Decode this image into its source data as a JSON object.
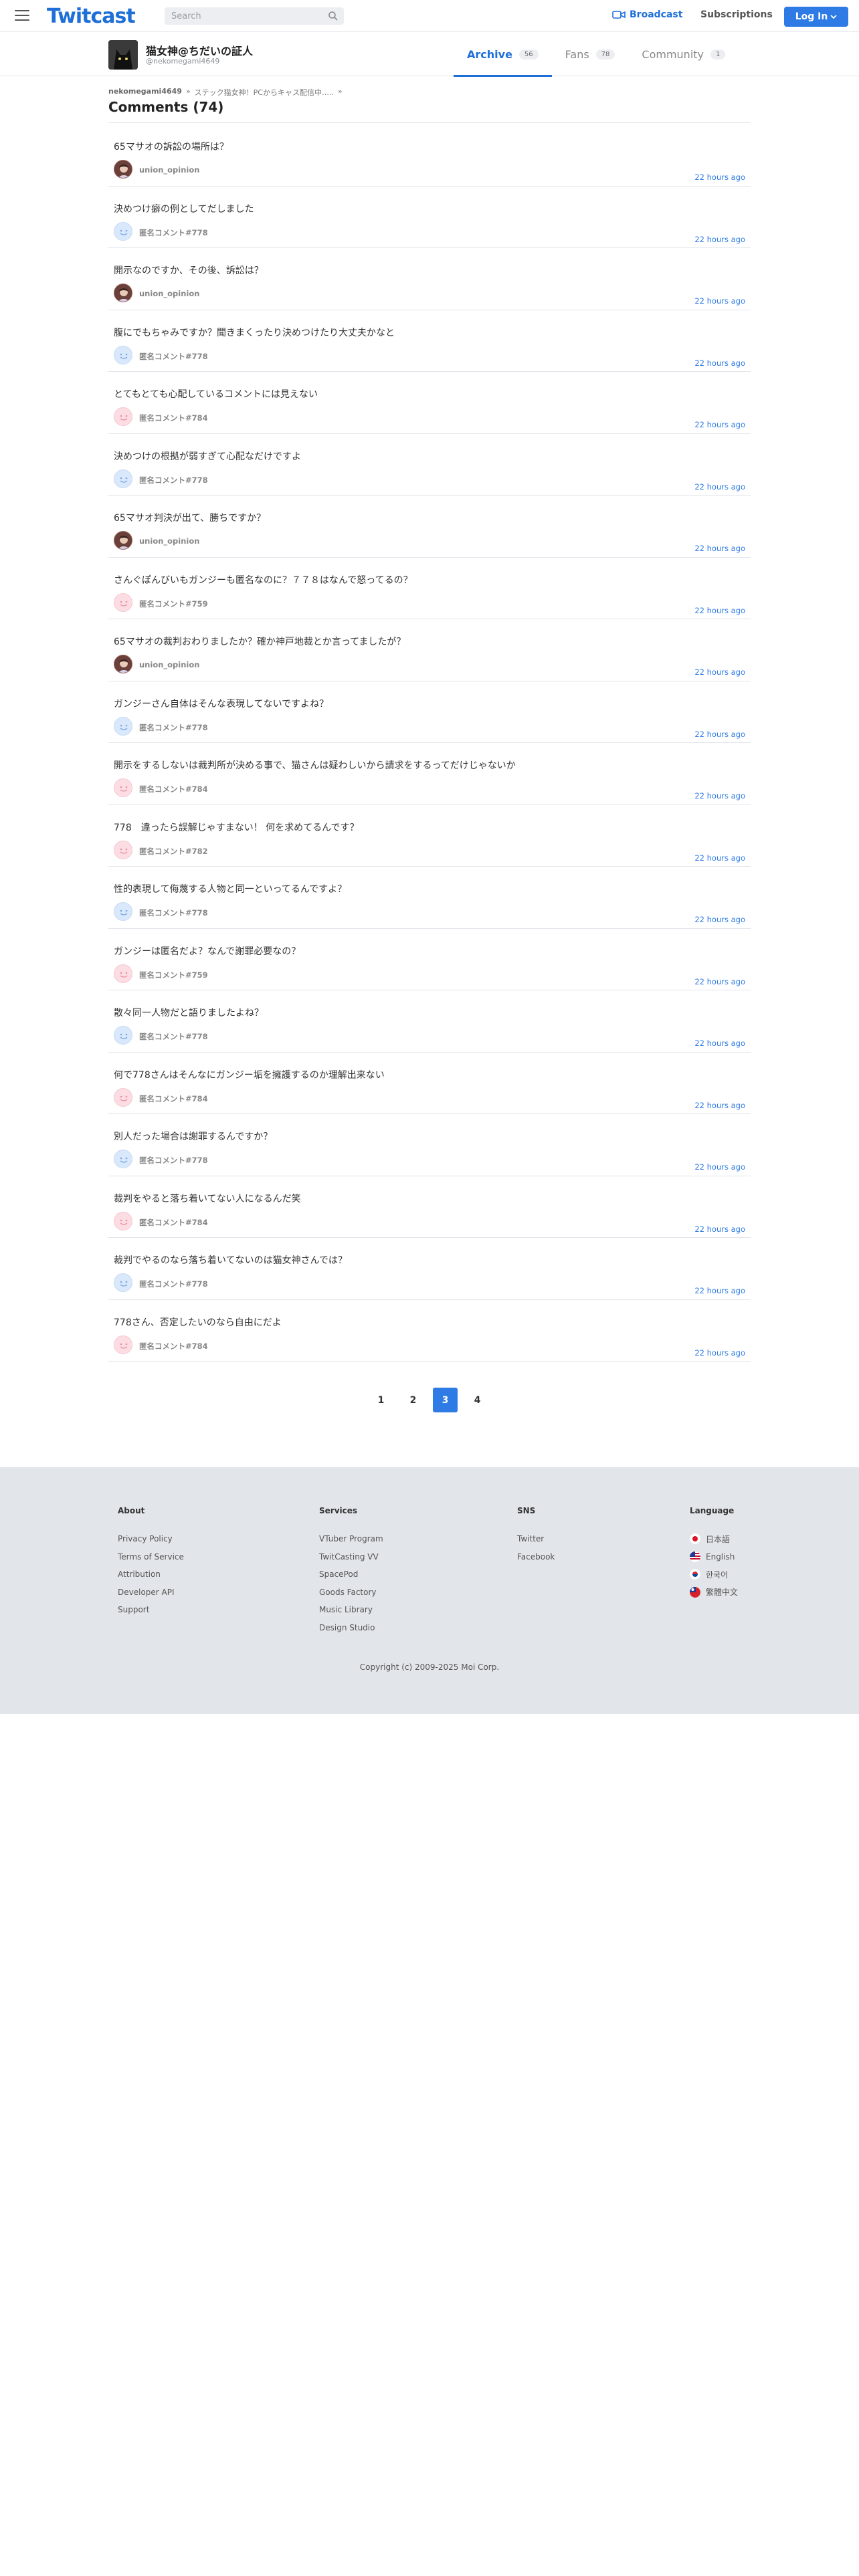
{
  "header": {
    "logo": "Twitcast",
    "search_placeholder": "Search",
    "broadcast_label": "Broadcast",
    "subscriptions_label": "Subscriptions",
    "login_label": "Log In"
  },
  "profile": {
    "name": "猫女神@ちだいの証人",
    "id": "@nekomegami4649",
    "tabs": [
      {
        "label": "Archive",
        "count": "56"
      },
      {
        "label": "Fans",
        "count": "78"
      },
      {
        "label": "Community",
        "count": "1"
      }
    ]
  },
  "breadcrumb": {
    "user": "nekomegami4649",
    "sep1": "»",
    "movie": "ステック猫女神！PCからキャス配信中‥...",
    "sep2": "»"
  },
  "page_title": "Comments (74)",
  "comments": [
    {
      "text": "65マサオの訴訟の場所は？",
      "author": "union_opinion",
      "time": "22 hours ago",
      "avatar": "user"
    },
    {
      "text": "決めつけ癖の例としてだしました",
      "author": "匿名コメント#778",
      "time": "22 hours ago",
      "avatar": "blue"
    },
    {
      "text": "開示なのですか、その後、訴訟は？",
      "author": "union_opinion",
      "time": "22 hours ago",
      "avatar": "user"
    },
    {
      "text": "腹にでもちゃみですか？聞きまくったり決めつけたり大丈夫かなと",
      "author": "匿名コメント#778",
      "time": "22 hours ago",
      "avatar": "blue"
    },
    {
      "text": "とてもとても心配しているコメントには見えない",
      "author": "匿名コメント#784",
      "time": "22 hours ago",
      "avatar": "pink"
    },
    {
      "text": "決めつけの根拠が弱すぎて心配なだけですよ",
      "author": "匿名コメント#778",
      "time": "22 hours ago",
      "avatar": "blue"
    },
    {
      "text": "65マサオ判決が出て、勝ちですか？",
      "author": "union_opinion",
      "time": "22 hours ago",
      "avatar": "user"
    },
    {
      "text": "さんぐぽんびいもガンジーも匿名なのに？７７８はなんで怒ってるの？",
      "author": "匿名コメント#759",
      "time": "22 hours ago",
      "avatar": "pink"
    },
    {
      "text": "65マサオの裁判おわりましたか？確か神戸地裁とか言ってましたが？",
      "author": "union_opinion",
      "time": "22 hours ago",
      "avatar": "user"
    },
    {
      "text": "ガンジーさん自体はそんな表現してないですよね？",
      "author": "匿名コメント#778",
      "time": "22 hours ago",
      "avatar": "blue"
    },
    {
      "text": "開示をするしないは裁判所が決める事で、猫さんは疑わしいから請求をするってだけじゃないか",
      "author": "匿名コメント#784",
      "time": "22 hours ago",
      "avatar": "pink"
    },
    {
      "text": "778　違ったら誤解じゃすまない！ 何を求めてるんです？",
      "author": "匿名コメント#782",
      "time": "22 hours ago",
      "avatar": "pink"
    },
    {
      "text": "性的表現して侮蔑する人物と同一といってるんですよ？",
      "author": "匿名コメント#778",
      "time": "22 hours ago",
      "avatar": "blue"
    },
    {
      "text": "ガンジーは匿名だよ？なんで謝罪必要なの？",
      "author": "匿名コメント#759",
      "time": "22 hours ago",
      "avatar": "pink"
    },
    {
      "text": "散々同一人物だと語りましたよね？",
      "author": "匿名コメント#778",
      "time": "22 hours ago",
      "avatar": "blue"
    },
    {
      "text": "何で778さんはそんなにガンジー垢を擁護するのか理解出来ない",
      "author": "匿名コメント#784",
      "time": "22 hours ago",
      "avatar": "pink"
    },
    {
      "text": "別人だった場合は謝罪するんですか？",
      "author": "匿名コメント#778",
      "time": "22 hours ago",
      "avatar": "blue"
    },
    {
      "text": "裁判をやると落ち着いてない人になるんだ笑",
      "author": "匿名コメント#784",
      "time": "22 hours ago",
      "avatar": "pink"
    },
    {
      "text": "裁判でやるのなら落ち着いてないのは猫女神さんでは？",
      "author": "匿名コメント#778",
      "time": "22 hours ago",
      "avatar": "blue"
    },
    {
      "text": "778さん、否定したいのなら自由にだよ",
      "author": "匿名コメント#784",
      "time": "22 hours ago",
      "avatar": "pink"
    }
  ],
  "pagination": [
    "1",
    "2",
    "3",
    "4"
  ],
  "pagination_active": "3",
  "footer": {
    "about": {
      "title": "About",
      "links": [
        "Privacy Policy",
        "Terms of Service",
        "Attribution",
        "Developer API",
        "Support"
      ]
    },
    "services": {
      "title": "Services",
      "links": [
        "VTuber Program",
        "TwitCasting VV",
        "SpacePod",
        "Goods Factory",
        "Music Library",
        "Design Studio"
      ]
    },
    "sns": {
      "title": "SNS",
      "links": [
        "Twitter",
        "Facebook"
      ]
    },
    "language": {
      "title": "Language",
      "links": [
        "日本語",
        "English",
        "한국어",
        "繁體中文"
      ]
    },
    "copyright": "Copyright (c) 2009-2025 Moi Corp."
  },
  "colors": {
    "accent": "#2e7be6",
    "footer_bg": "#e2e5e9"
  }
}
